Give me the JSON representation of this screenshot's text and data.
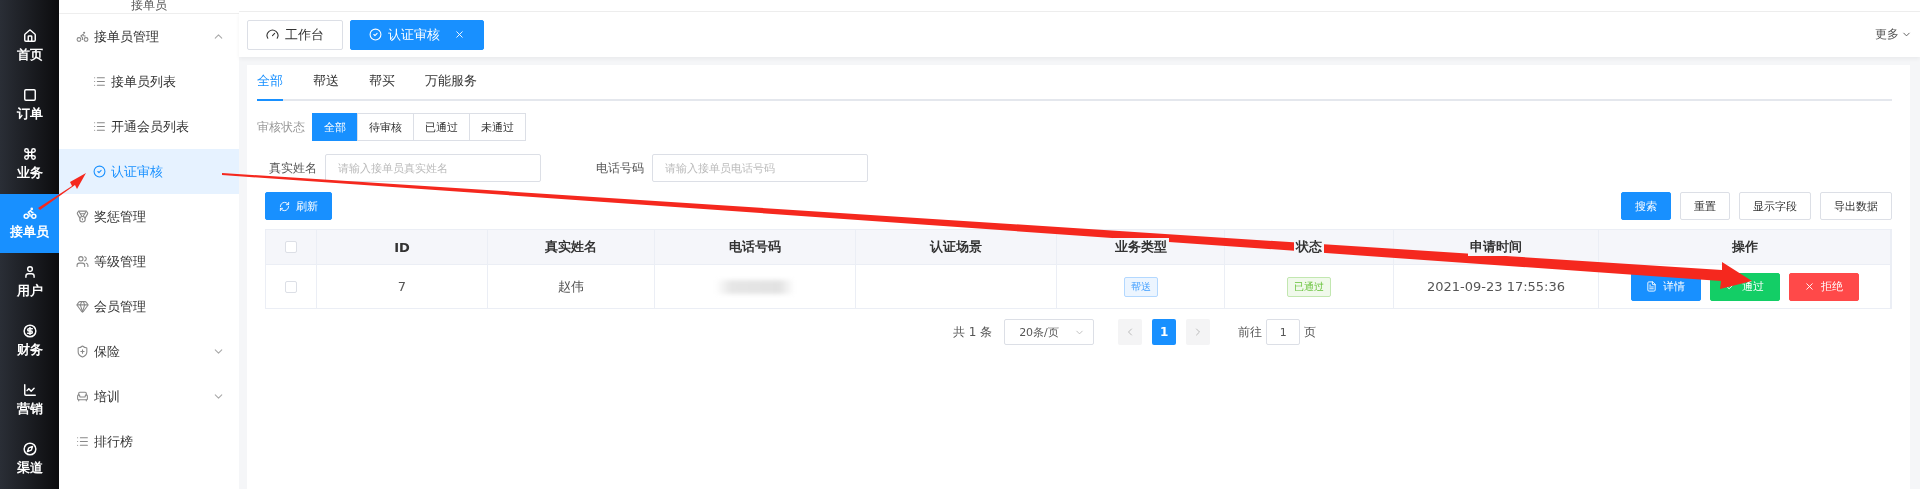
{
  "rail": [
    {
      "label": "首页",
      "selected": false
    },
    {
      "label": "订单",
      "selected": false
    },
    {
      "label": "业务",
      "selected": false
    },
    {
      "label": "接单员",
      "selected": true
    },
    {
      "label": "用户",
      "selected": false
    },
    {
      "label": "财务",
      "selected": false
    },
    {
      "label": "营销",
      "selected": false
    },
    {
      "label": "渠道",
      "selected": false
    }
  ],
  "sidebar": {
    "title": "接单员",
    "items": [
      {
        "label": "接单员管理",
        "selected": false,
        "expanded": true,
        "children": [
          {
            "label": "接单员列表",
            "selected": false
          },
          {
            "label": "开通会员列表",
            "selected": false
          },
          {
            "label": "认证审核",
            "selected": true
          }
        ]
      },
      {
        "label": "奖惩管理",
        "selected": false
      },
      {
        "label": "等级管理",
        "selected": false
      },
      {
        "label": "会员管理",
        "selected": false
      },
      {
        "label": "保险",
        "selected": false,
        "expanded": false
      },
      {
        "label": "培训",
        "selected": false,
        "expanded": false
      },
      {
        "label": "排行榜",
        "selected": false
      }
    ]
  },
  "page_tabs": [
    {
      "label": "工作台",
      "selected": false,
      "closable": false
    },
    {
      "label": "认证审核",
      "selected": true,
      "closable": true
    }
  ],
  "more": "更多",
  "sub_tabs": [
    {
      "label": "全部",
      "selected": true
    },
    {
      "label": "帮送",
      "selected": false
    },
    {
      "label": "帮买",
      "selected": false
    },
    {
      "label": "万能服务",
      "selected": false
    }
  ],
  "status_filter": {
    "label": "审核状态",
    "options": [
      {
        "label": "全部",
        "selected": true
      },
      {
        "label": "待审核",
        "selected": false
      },
      {
        "label": "已通过",
        "selected": false
      },
      {
        "label": "未通过",
        "selected": false
      }
    ]
  },
  "fields": [
    {
      "label": "真实姓名",
      "placeholder": "请输入接单员真实姓名"
    },
    {
      "label": "电话号码",
      "placeholder": "请输入接单员电话号码"
    }
  ],
  "refresh": "刷新",
  "tools": [
    {
      "label": "搜索",
      "kind": "primary"
    },
    {
      "label": "重置",
      "kind": "default"
    },
    {
      "label": "显示字段",
      "kind": "default"
    },
    {
      "label": "导出数据",
      "kind": "default"
    }
  ],
  "table": {
    "all_checked": false,
    "columns": [
      "ID",
      "真实姓名",
      "电话号码",
      "认证场景",
      "业务类型",
      "状态",
      "申请时间",
      "操作"
    ],
    "rows": [
      {
        "checked": false,
        "id": "7",
        "name": "赵伟",
        "business_type": {
          "label": "帮送",
          "kind": "info"
        },
        "status": {
          "label": "已通过",
          "kind": "success"
        },
        "time": "2021-09-23 17:55:36",
        "actions": [
          {
            "label": "详情",
            "kind": "primary"
          },
          {
            "label": "通过",
            "kind": "success"
          },
          {
            "label": "拒绝",
            "kind": "danger"
          }
        ]
      }
    ]
  },
  "pagination": {
    "total": "共 1 条",
    "page_size": "20条/页",
    "pages": [
      {
        "label": "1",
        "selected": true
      }
    ],
    "goto": "前往",
    "goto_value": "1",
    "goto_suffix": "页"
  }
}
